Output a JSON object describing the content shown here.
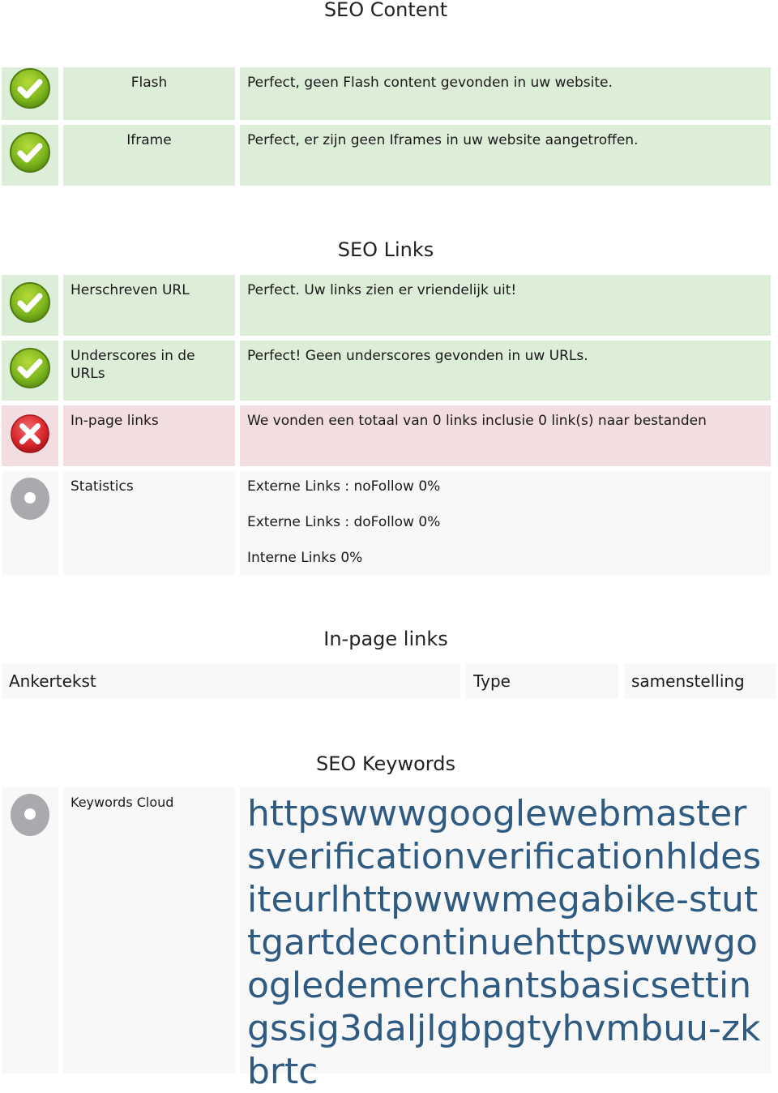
{
  "sections": {
    "content": {
      "title": "SEO Content",
      "rows": [
        {
          "status": "pass",
          "label": "Flash",
          "message": "Perfect, geen Flash content gevonden in uw website."
        },
        {
          "status": "pass",
          "label": "Iframe",
          "message": "Perfect, er zijn geen Iframes in uw website aangetroffen."
        }
      ]
    },
    "links": {
      "title": "SEO Links",
      "rows": [
        {
          "status": "pass",
          "label": "Herschreven URL",
          "message": "Perfect. Uw links zien er vriendelijk uit!"
        },
        {
          "status": "pass",
          "label": "Underscores in de URLs",
          "message": "Perfect! Geen underscores gevonden in uw URLs."
        },
        {
          "status": "fail",
          "label": "In-page links",
          "message": "We vonden een totaal van 0 links inclusie 0 link(s) naar bestanden"
        },
        {
          "status": "info",
          "label": "Statistics",
          "lines": [
            "Externe Links : noFollow 0%",
            "Externe Links : doFollow 0%",
            "Interne Links 0%"
          ]
        }
      ]
    },
    "inpage": {
      "title": "In-page links",
      "columns": [
        "Ankertekst",
        "Type",
        "samenstelling"
      ]
    },
    "keywords": {
      "title": "SEO Keywords",
      "label": "Keywords Cloud",
      "cloud": "httpswwwgooglewebmastersverificationverificationhldesiteurlhttpwwwmegabike-stuttgartdecontinuehttpswwwgoogledemerchantsbasicsettingssig3daljlgbpgtyhvmbuu-zkbrtc"
    }
  },
  "icons": {
    "pass": "check-circle-icon",
    "fail": "x-circle-icon",
    "info": "neutral-circle-icon"
  },
  "colors": {
    "pass_bg": "#ddeed8",
    "fail_bg": "#f2dde0",
    "neutral_bg": "#f8f8f8",
    "keyword_text": "#2f5b82"
  }
}
